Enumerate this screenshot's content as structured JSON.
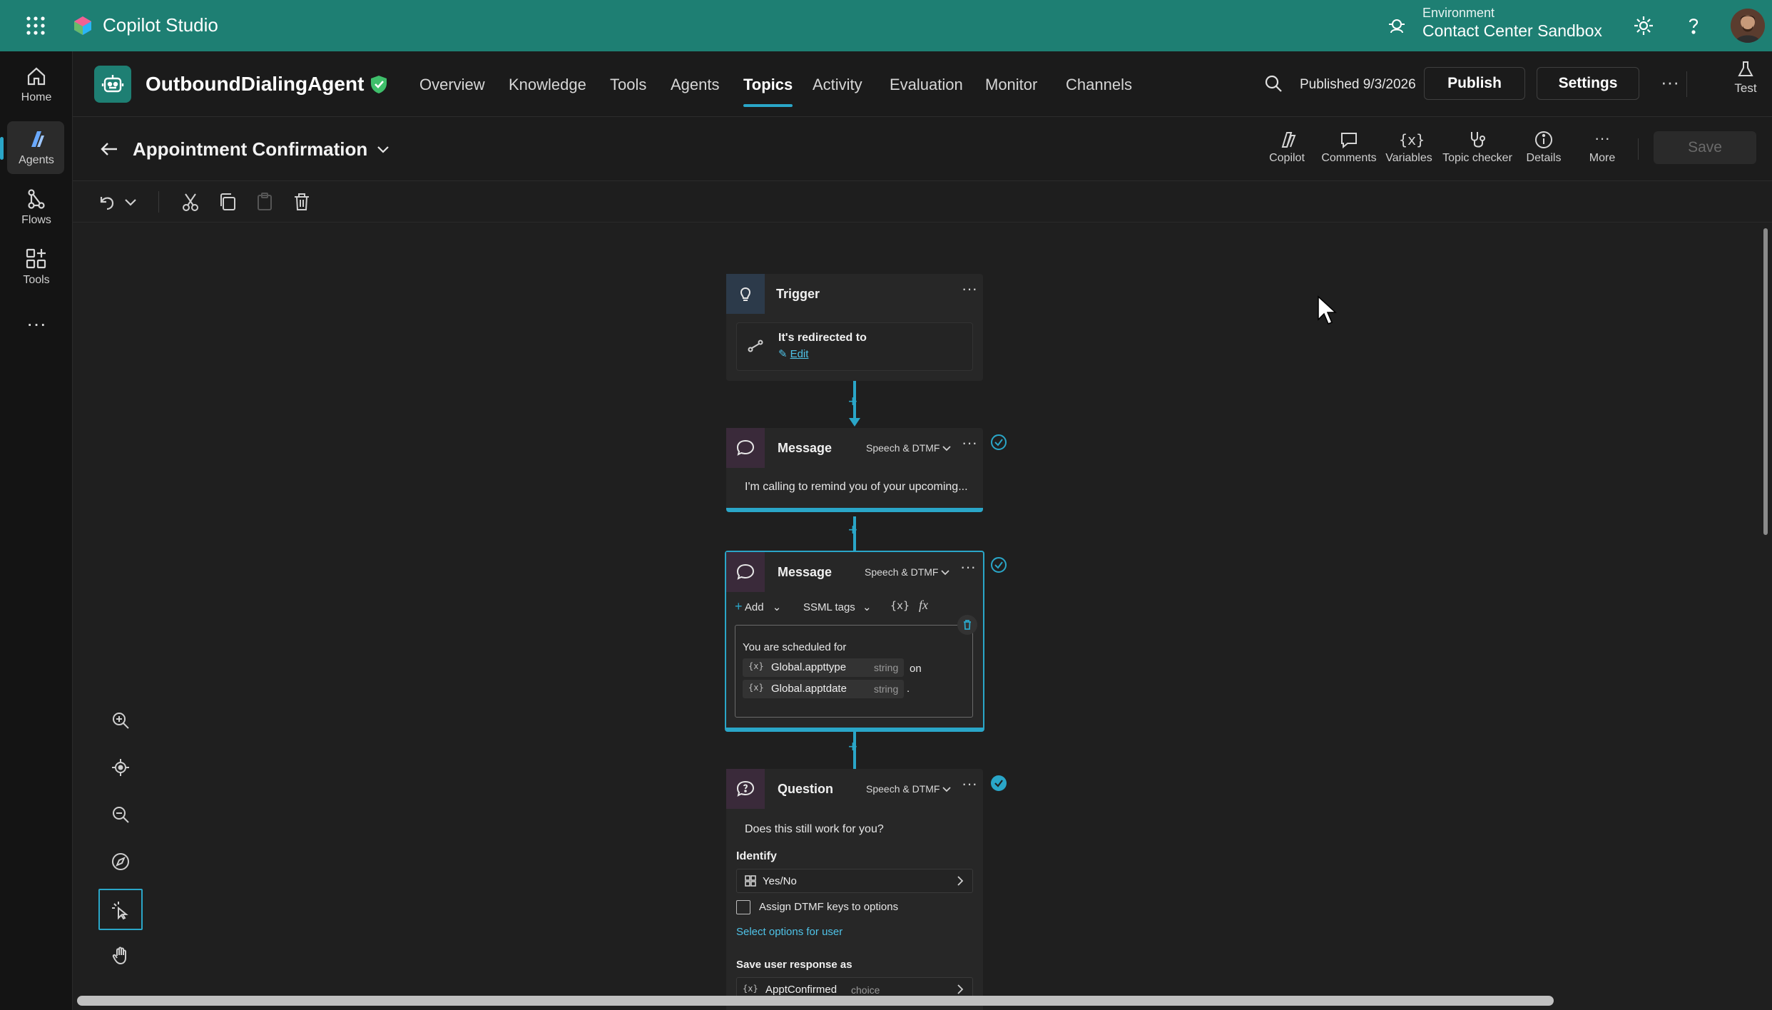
{
  "topbar": {
    "app_name": "Copilot Studio",
    "environment_label": "Environment",
    "environment_name": "Contact Center Sandbox"
  },
  "rail": {
    "items": [
      {
        "label": "Home",
        "icon": "home-icon"
      },
      {
        "label": "Agents",
        "icon": "agents-icon"
      },
      {
        "label": "Flows",
        "icon": "flows-icon"
      },
      {
        "label": "Tools",
        "icon": "tools-icon"
      }
    ]
  },
  "agent": {
    "name": "OutboundDialingAgent",
    "tabs": [
      "Overview",
      "Knowledge",
      "Tools",
      "Agents",
      "Topics",
      "Activity",
      "Evaluation",
      "Monitor",
      "Channels"
    ],
    "active_tab": "Topics",
    "published": "Published 9/3/2026",
    "publish_label": "Publish",
    "settings_label": "Settings",
    "test_label": "Test"
  },
  "topic": {
    "title": "Appointment Confirmation",
    "tools": [
      "Copilot",
      "Comments",
      "Variables",
      "Topic checker",
      "Details",
      "More"
    ],
    "save_label": "Save"
  },
  "nodes": {
    "trigger": {
      "title": "Trigger",
      "condition": "It's redirected to",
      "edit_label": "Edit"
    },
    "message1": {
      "title": "Message",
      "mode": "Speech & DTMF",
      "text": "I'm calling to remind you of your upcoming..."
    },
    "message2": {
      "title": "Message",
      "mode": "Speech & DTMF",
      "add_label": "Add",
      "ssml_label": "SSML tags",
      "text_intro": "You are scheduled for",
      "var1_name": "Global.appttype",
      "var1_type": "string",
      "connector_on": "on",
      "var2_name": "Global.apptdate",
      "var2_type": "string",
      "tail": "."
    },
    "question": {
      "title": "Question",
      "mode": "Speech & DTMF",
      "prompt": "Does this still work for you?",
      "identify_label": "Identify",
      "identify_value": "Yes/No",
      "dtmf_label": "Assign DTMF keys to options",
      "select_options": "Select options for user",
      "save_label": "Save user response as",
      "save_var": "ApptConfirmed",
      "save_type": "choice"
    }
  },
  "colors": {
    "brand": "#1e7f73",
    "accent": "#2aa6c8"
  }
}
